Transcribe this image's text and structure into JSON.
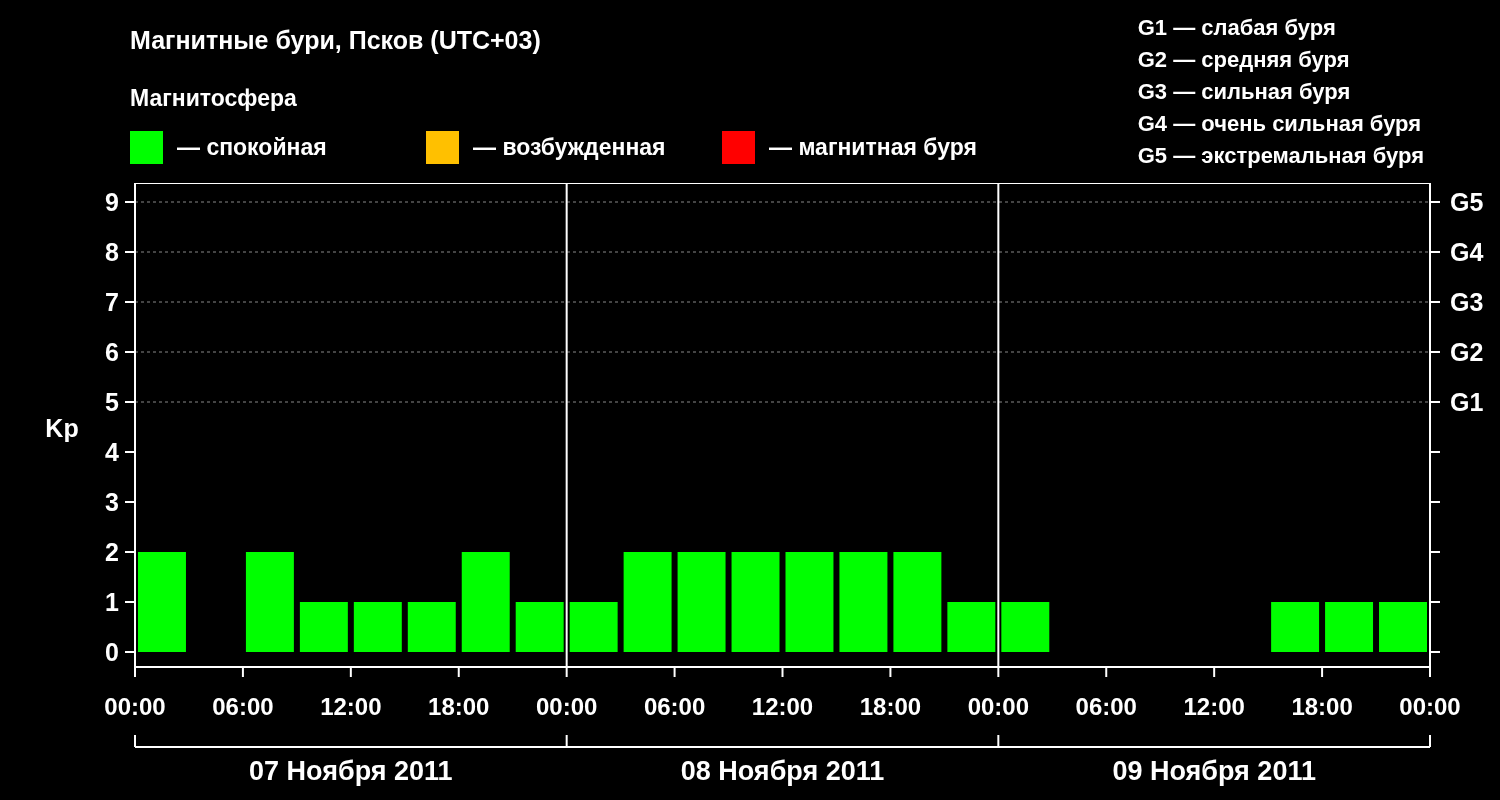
{
  "title": "Магнитные бури, Псков (UTC+03)",
  "legend": {
    "heading": "Магнитосфера",
    "items": [
      {
        "label": "— спокойная",
        "color": "#00ff00"
      },
      {
        "label": "— возбужденная",
        "color": "#ffc000"
      },
      {
        "label": "— магнитная буря",
        "color": "#ff0000"
      }
    ]
  },
  "storm_scale": [
    "G1 — слабая буря",
    "G2 — средняя буря",
    "G3 — сильная буря",
    "G4 — очень сильная буря",
    "G5 — экстремальная буря"
  ],
  "chart": {
    "chart_data": {
      "type": "bar",
      "ylabel": "Kp",
      "grid": true,
      "x": [
        "2011-11-07 01:30",
        "2011-11-07 04:30",
        "2011-11-07 07:30",
        "2011-11-07 10:30",
        "2011-11-07 13:30",
        "2011-11-07 16:30",
        "2011-11-07 19:30",
        "2011-11-07 22:30",
        "2011-11-08 01:30",
        "2011-11-08 04:30",
        "2011-11-08 07:30",
        "2011-11-08 10:30",
        "2011-11-08 13:30",
        "2011-11-08 16:30",
        "2011-11-08 19:30",
        "2011-11-08 22:30",
        "2011-11-09 01:30",
        "2011-11-09 04:30",
        "2011-11-09 07:30",
        "2011-11-09 10:30",
        "2011-11-09 13:30",
        "2011-11-09 16:30",
        "2011-11-09 19:30",
        "2011-11-09 22:30"
      ],
      "series": [
        {
          "color": "#00ff00",
          "values": [
            2,
            0,
            2,
            1,
            1,
            1,
            2,
            1,
            1,
            2,
            2,
            2,
            2,
            2,
            2,
            1,
            1,
            0,
            0,
            0,
            0,
            1,
            1,
            1
          ]
        }
      ],
      "xlim": [
        "2011-11-07 00:00",
        "2011-11-10 00:00"
      ],
      "ylim": [
        -0.3,
        9.38
      ],
      "xticks": [
        {
          "value": "2011-11-07 00:00",
          "label": "00:00"
        },
        {
          "value": "2011-11-07 06:00",
          "label": "06:00"
        },
        {
          "value": "2011-11-07 12:00",
          "label": "12:00"
        },
        {
          "value": "2011-11-07 18:00",
          "label": "18:00"
        },
        {
          "value": "2011-11-08 00:00",
          "label": "00:00"
        },
        {
          "value": "2011-11-08 06:00",
          "label": "06:00"
        },
        {
          "value": "2011-11-08 12:00",
          "label": "12:00"
        },
        {
          "value": "2011-11-08 18:00",
          "label": "18:00"
        },
        {
          "value": "2011-11-09 00:00",
          "label": "00:00"
        },
        {
          "value": "2011-11-09 06:00",
          "label": "06:00"
        },
        {
          "value": "2011-11-09 12:00",
          "label": "12:00"
        },
        {
          "value": "2011-11-09 18:00",
          "label": "18:00"
        },
        {
          "value": "2011-11-10 00:00",
          "label": "00:00"
        }
      ],
      "yticks": [
        0,
        1,
        2,
        3,
        4,
        5,
        6,
        7,
        8,
        9
      ]
    },
    "right_axis": [
      "G5",
      "G4",
      "G3",
      "G2",
      "G1"
    ],
    "day_labels": [
      "07 Ноября 2011",
      "08 Ноября 2011",
      "09 Ноября 2011"
    ]
  }
}
